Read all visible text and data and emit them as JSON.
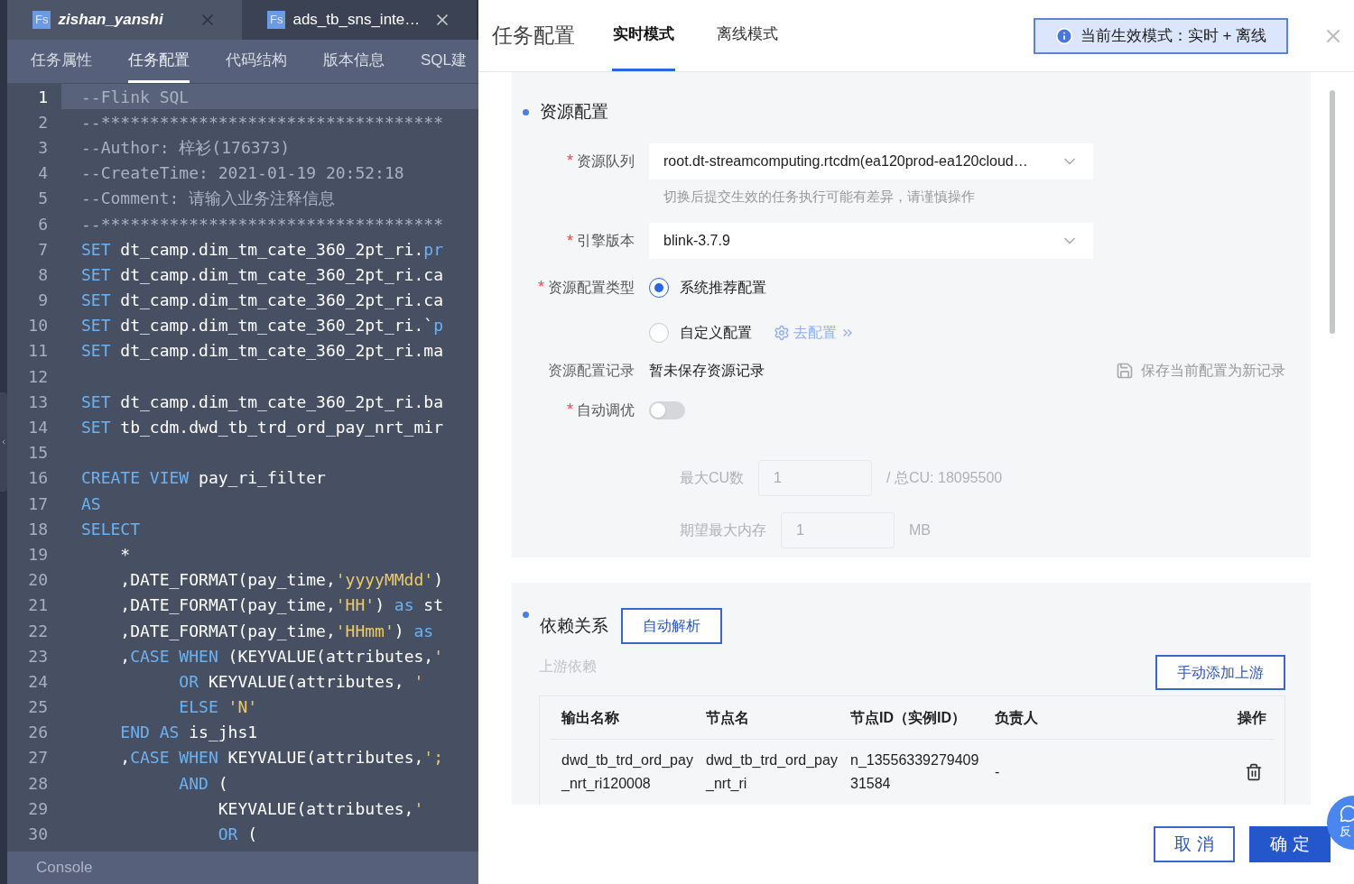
{
  "file_tabs": [
    {
      "badge": "Fs",
      "title": "zishan_yanshi",
      "selected": true
    },
    {
      "badge": "Fs",
      "title": "ads_tb_sns_inte…",
      "selected": false
    }
  ],
  "sub_tabs": [
    {
      "label": "任务属性",
      "selected": false
    },
    {
      "label": "任务配置",
      "selected": true
    },
    {
      "label": "代码结构",
      "selected": false
    },
    {
      "label": "版本信息",
      "selected": false
    },
    {
      "label": "SQL建",
      "selected": false
    }
  ],
  "code_lines": [
    {
      "number": "1",
      "current": true,
      "tokens": [
        {
          "kind": "comment",
          "text": "--Flink SQL"
        }
      ]
    },
    {
      "number": "2",
      "current": false,
      "tokens": [
        {
          "kind": "comment",
          "text": "--***********************************"
        }
      ]
    },
    {
      "number": "3",
      "current": false,
      "tokens": [
        {
          "kind": "comment",
          "text": "--Author: 梓衫(176373)"
        }
      ]
    },
    {
      "number": "4",
      "current": false,
      "tokens": [
        {
          "kind": "comment",
          "text": "--CreateTime: 2021-01-19 20:52:18"
        }
      ]
    },
    {
      "number": "5",
      "current": false,
      "tokens": [
        {
          "kind": "comment",
          "text": "--Comment: 请输入业务注释信息"
        }
      ]
    },
    {
      "number": "6",
      "current": false,
      "tokens": [
        {
          "kind": "comment",
          "text": "--***********************************"
        }
      ]
    },
    {
      "number": "7",
      "current": false,
      "tokens": [
        {
          "kind": "keyword",
          "text": "SET"
        },
        {
          "kind": "plain",
          "text": " dt_camp.dim_tm_cate_360_2pt_ri."
        },
        {
          "kind": "keyword",
          "text": "pr"
        }
      ]
    },
    {
      "number": "8",
      "current": false,
      "tokens": [
        {
          "kind": "keyword",
          "text": "SET"
        },
        {
          "kind": "plain",
          "text": " dt_camp.dim_tm_cate_360_2pt_ri.ca"
        }
      ]
    },
    {
      "number": "9",
      "current": false,
      "tokens": [
        {
          "kind": "keyword",
          "text": "SET"
        },
        {
          "kind": "plain",
          "text": " dt_camp.dim_tm_cate_360_2pt_ri.ca"
        }
      ]
    },
    {
      "number": "10",
      "current": false,
      "tokens": [
        {
          "kind": "keyword",
          "text": "SET"
        },
        {
          "kind": "plain",
          "text": " dt_camp.dim_tm_cate_360_2pt_ri.`"
        },
        {
          "kind": "keyword",
          "text": "p"
        }
      ]
    },
    {
      "number": "11",
      "current": false,
      "tokens": [
        {
          "kind": "keyword",
          "text": "SET"
        },
        {
          "kind": "plain",
          "text": " dt_camp.dim_tm_cate_360_2pt_ri.ma"
        }
      ]
    },
    {
      "number": "12",
      "current": false
    },
    {
      "number": "13",
      "current": false,
      "tokens": [
        {
          "kind": "keyword",
          "text": "SET"
        },
        {
          "kind": "plain",
          "text": " dt_camp.dim_tm_cate_360_2pt_ri.ba"
        }
      ]
    },
    {
      "number": "14",
      "current": false,
      "tokens": [
        {
          "kind": "keyword",
          "text": "SET"
        },
        {
          "kind": "plain",
          "text": " tb_cdm.dwd_tb_trd_ord_pay_nrt_mir"
        }
      ]
    },
    {
      "number": "15",
      "current": false
    },
    {
      "number": "16",
      "current": false,
      "tokens": [
        {
          "kind": "keyword",
          "text": "CREATE VIEW"
        },
        {
          "kind": "plain",
          "text": " pay_ri_filter"
        }
      ]
    },
    {
      "number": "17",
      "current": false,
      "tokens": [
        {
          "kind": "keyword",
          "text": "AS"
        }
      ]
    },
    {
      "number": "18",
      "current": false,
      "tokens": [
        {
          "kind": "keyword",
          "text": "SELECT"
        }
      ]
    },
    {
      "number": "19",
      "current": false,
      "tokens": [
        {
          "kind": "plain",
          "text": "    *"
        }
      ]
    },
    {
      "number": "20",
      "current": false,
      "tokens": [
        {
          "kind": "plain",
          "text": "    ,DATE_FORMAT(pay_time,"
        },
        {
          "kind": "string",
          "text": "'yyyyMMdd'"
        },
        {
          "kind": "plain",
          "text": ")"
        }
      ]
    },
    {
      "number": "21",
      "current": false,
      "tokens": [
        {
          "kind": "plain",
          "text": "    ,DATE_FORMAT(pay_time,"
        },
        {
          "kind": "string",
          "text": "'HH'"
        },
        {
          "kind": "plain",
          "text": ") "
        },
        {
          "kind": "keyword",
          "text": "as"
        },
        {
          "kind": "plain",
          "text": " st"
        }
      ]
    },
    {
      "number": "22",
      "current": false,
      "tokens": [
        {
          "kind": "plain",
          "text": "    ,DATE_FORMAT(pay_time,"
        },
        {
          "kind": "string",
          "text": "'HHmm'"
        },
        {
          "kind": "plain",
          "text": ") "
        },
        {
          "kind": "keyword",
          "text": "as"
        }
      ]
    },
    {
      "number": "23",
      "current": false,
      "tokens": [
        {
          "kind": "plain",
          "text": "    ,"
        },
        {
          "kind": "keyword",
          "text": "CASE WHEN"
        },
        {
          "kind": "plain",
          "text": " (KEYVALUE(attributes,"
        },
        {
          "kind": "string",
          "text": "'"
        }
      ]
    },
    {
      "number": "24",
      "current": false,
      "tokens": [
        {
          "kind": "keyword",
          "text": "          OR"
        },
        {
          "kind": "plain",
          "text": " KEYVALUE(attributes, "
        },
        {
          "kind": "string",
          "text": "'"
        }
      ]
    },
    {
      "number": "25",
      "current": false,
      "tokens": [
        {
          "kind": "keyword",
          "text": "          ELSE"
        },
        {
          "kind": "string",
          "text": " 'N'"
        }
      ]
    },
    {
      "number": "26",
      "current": false,
      "tokens": [
        {
          "kind": "keyword",
          "text": "    END AS"
        },
        {
          "kind": "plain",
          "text": " is_jhs1"
        }
      ]
    },
    {
      "number": "27",
      "current": false,
      "tokens": [
        {
          "kind": "plain",
          "text": "    ,"
        },
        {
          "kind": "keyword",
          "text": "CASE WHEN"
        },
        {
          "kind": "plain",
          "text": " KEYVALUE(attributes,"
        },
        {
          "kind": "string",
          "text": "';"
        }
      ]
    },
    {
      "number": "28",
      "current": false,
      "tokens": [
        {
          "kind": "keyword",
          "text": "          AND"
        },
        {
          "kind": "plain",
          "text": " ("
        }
      ]
    },
    {
      "number": "29",
      "current": false,
      "tokens": [
        {
          "kind": "plain",
          "text": "              KEYVALUE(attributes,"
        },
        {
          "kind": "string",
          "text": "'"
        }
      ]
    },
    {
      "number": "30",
      "current": false,
      "tokens": [
        {
          "kind": "keyword",
          "text": "              OR"
        },
        {
          "kind": "plain",
          "text": " ("
        }
      ]
    }
  ],
  "console": {
    "label": "Console"
  },
  "drawer": {
    "title": "任务配置",
    "mode_tabs": [
      {
        "label": "实时模式",
        "selected": true
      },
      {
        "label": "离线模式",
        "selected": false
      }
    ],
    "mode_notice": "当前生效模式：实时 + 离线",
    "resource_section": {
      "title": "资源配置",
      "fields": [
        {
          "kind": "select",
          "required": true,
          "label": "资源队列",
          "value": "root.dt-streamcomputing.rtcdm(ea120prod-ea120cloud…",
          "hint": "切换后提交生效的任务执行可能有差异，请谨慎操作"
        },
        {
          "kind": "select",
          "required": true,
          "label": "引擎版本",
          "value": "blink-3.7.9"
        },
        {
          "kind": "radio",
          "required": true,
          "label": "资源配置类型",
          "options": [
            {
              "label": "系统推荐配置",
              "selected": true
            },
            {
              "label": "自定义配置",
              "selected": false,
              "link": "去配置"
            }
          ]
        },
        {
          "kind": "record",
          "required": false,
          "label": "资源配置记录",
          "value": "暂未保存资源记录",
          "action": "保存当前配置为新记录"
        },
        {
          "kind": "switch",
          "required": true,
          "label": "自动调优",
          "on": false
        },
        {
          "kind": "number",
          "disabled": true,
          "label": "最大CU数",
          "placeholder": "1",
          "suffix": "/ 总CU: 18095500"
        },
        {
          "kind": "number",
          "disabled": true,
          "label": "期望最大内存",
          "placeholder": "1",
          "suffix": "MB"
        }
      ]
    },
    "dependency_section": {
      "title": "依赖关系",
      "parse_button": "自动解析",
      "subtitle": "上游依赖",
      "add_button": "手动添加上游",
      "columns": [
        "输出名称",
        "节点名",
        "节点ID（实例ID）",
        "负责人",
        "操作"
      ],
      "rows": [
        {
          "cells": [
            "dwd_tb_trd_ord_pay_nrt_ri120008",
            "dwd_tb_trd_ord_pay_nrt_ri",
            "n_1355633927940931584",
            "-"
          ]
        }
      ]
    },
    "buttons": [
      {
        "label": "取 消",
        "kind": "secondary"
      },
      {
        "label": "确 定",
        "kind": "primary"
      }
    ],
    "feedback": "反"
  }
}
